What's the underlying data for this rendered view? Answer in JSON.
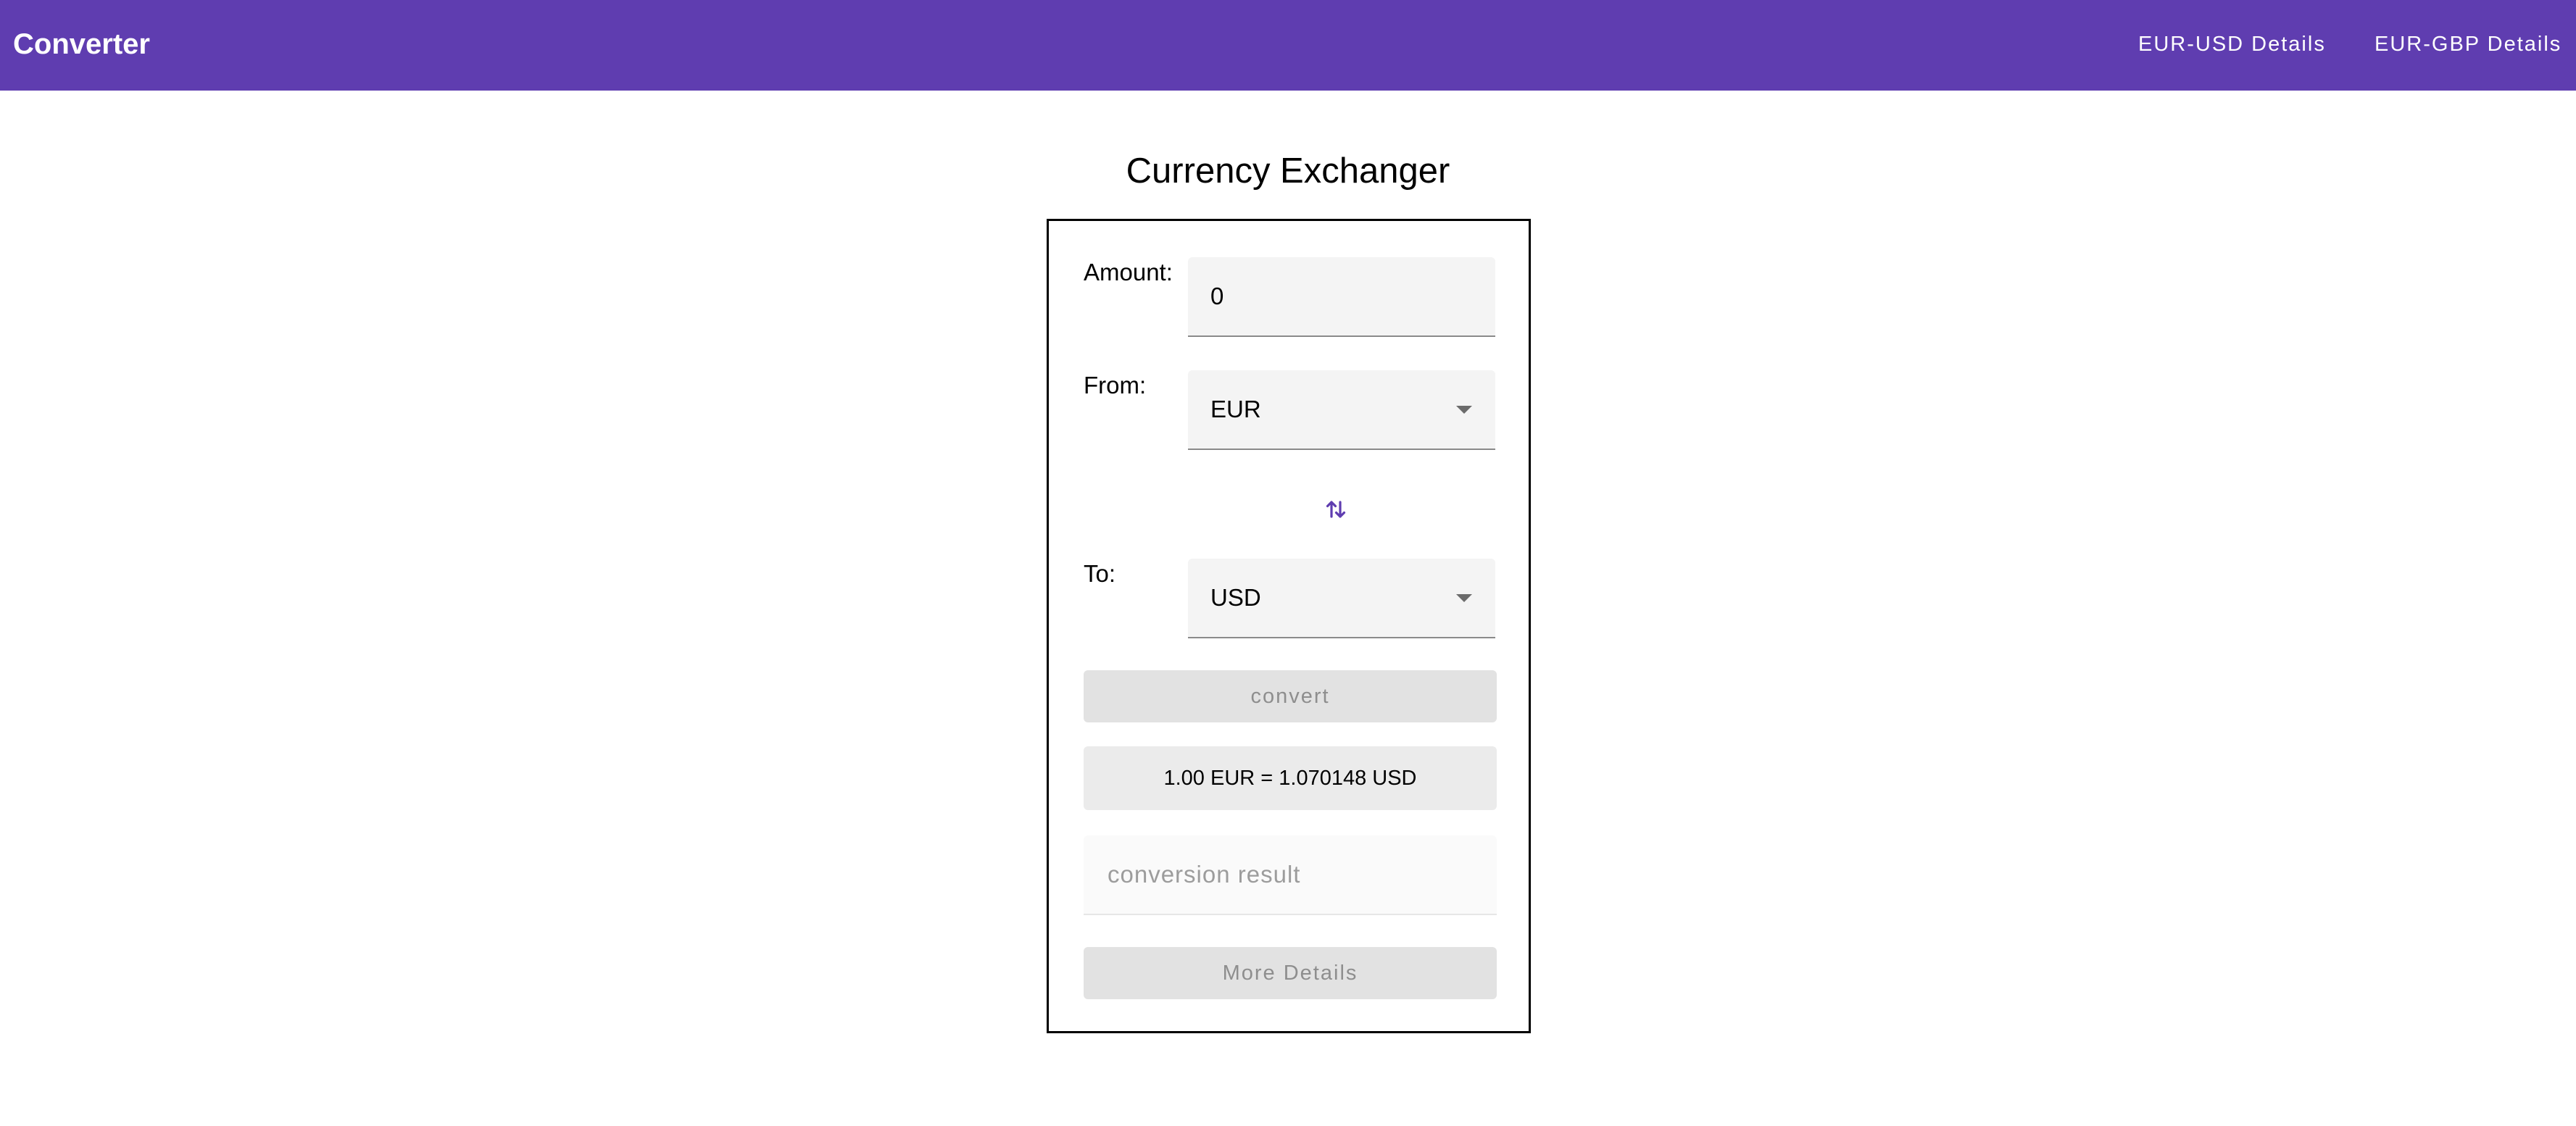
{
  "toolbar": {
    "title": "Converter",
    "nav_links": [
      "EUR-USD Details",
      "EUR-GBP Details"
    ],
    "background_color": "#5f3db0"
  },
  "page": {
    "heading": "Currency Exchanger"
  },
  "form": {
    "amount": {
      "label": "Amount:",
      "value": "0"
    },
    "from": {
      "label": "From:",
      "selected": "EUR"
    },
    "swap_icon": "swap-vertical-icon",
    "to": {
      "label": "To:",
      "selected": "USD"
    },
    "convert_label": "convert",
    "rate_text": "1.00 EUR = 1.070148 USD",
    "result_placeholder": "conversion result",
    "details_label": "More Details"
  },
  "colors": {
    "accent": "#5f3db0",
    "button_disabled_bg": "#e2e2e2",
    "button_disabled_text": "#8e8e8e"
  }
}
